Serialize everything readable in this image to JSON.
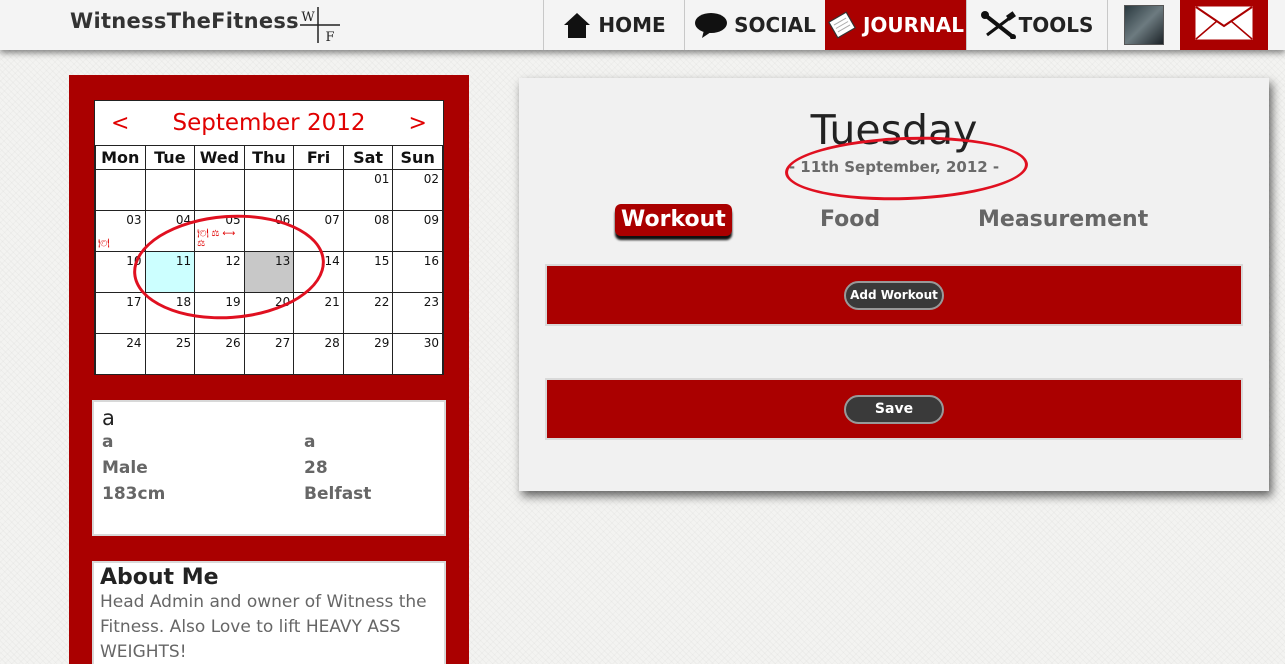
{
  "header": {
    "logo_text": "WitnessTheFitness",
    "logo_mark_letters": [
      "W",
      "F"
    ],
    "nav": [
      {
        "label": "HOME",
        "icon": "home-icon"
      },
      {
        "label": "SOCIAL",
        "icon": "speech-bubble-icon"
      },
      {
        "label": "JOURNAL",
        "icon": "notebook-icon",
        "active": true
      },
      {
        "label": "TOOLS",
        "icon": "wrench-screwdriver-icon"
      },
      {
        "label": "",
        "icon": "avatar"
      },
      {
        "label": "",
        "icon": "mail-icon"
      }
    ]
  },
  "calendar": {
    "prev": "<",
    "next": ">",
    "title": "September 2012",
    "weekdays": [
      "Mon",
      "Tue",
      "Wed",
      "Thu",
      "Fri",
      "Sat",
      "Sun"
    ],
    "weeks": [
      [
        "",
        "",
        "",
        "",
        "",
        "01",
        "02"
      ],
      [
        "03",
        "04",
        "05",
        "06",
        "07",
        "08",
        "09"
      ],
      [
        "10",
        "11",
        "12",
        "13",
        "14",
        "15",
        "16"
      ],
      [
        "17",
        "18",
        "19",
        "20",
        "21",
        "22",
        "23"
      ],
      [
        "24",
        "25",
        "26",
        "27",
        "28",
        "29",
        "30"
      ]
    ],
    "selected_day": "11",
    "today_day": "13",
    "marks": {
      "03": "food-icon",
      "05": "food-icon scale-icon dumbbell-icon scale-icon"
    }
  },
  "profile": {
    "name": "a",
    "rows": [
      [
        "a",
        "a"
      ],
      [
        "Male",
        "28"
      ],
      [
        "183cm",
        "Belfast"
      ]
    ]
  },
  "about": {
    "title": "About Me",
    "text": "Head Admin and owner of Witness the Fitness. Also Love to lift HEAVY ASS WEIGHTS!"
  },
  "main": {
    "day": "Tuesday",
    "date": "- 11th September, 2012 -",
    "tabs": [
      {
        "label": "Workout",
        "active": true
      },
      {
        "label": "Food"
      },
      {
        "label": "Measurement"
      }
    ],
    "add_workout_label": "Add Workout",
    "save_label": "Save"
  },
  "colors": {
    "brand": "#aa0000",
    "calendar_title": "#e00000",
    "selected_day": "#ccffff",
    "today": "#c8c8c8"
  }
}
